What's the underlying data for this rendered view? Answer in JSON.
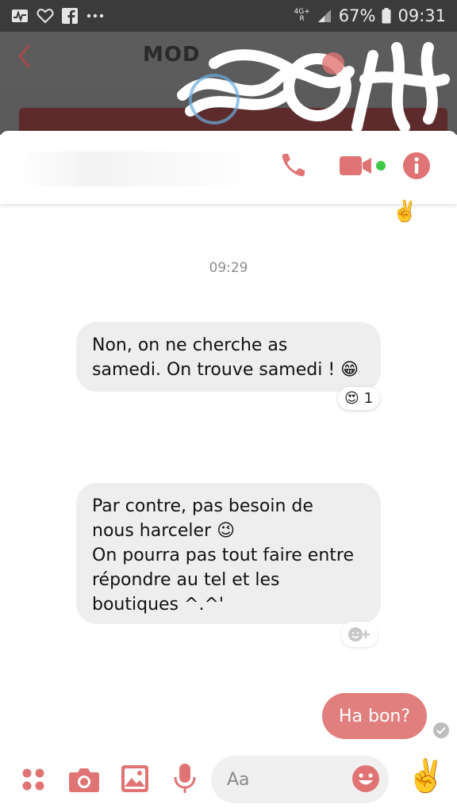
{
  "status_bar": {
    "network_top": "4G+",
    "network_bottom": "R",
    "battery": "67%",
    "time": "09:31"
  },
  "background_app": {
    "back_icon": "chevron-left-icon",
    "title_fragment": "MOD"
  },
  "chat_header": {
    "icons": [
      "phone-icon",
      "video-camera-icon",
      "info-icon"
    ],
    "accent": "#e07474",
    "online_color": "#3ec94a"
  },
  "messages": {
    "timestamp": "09:29",
    "m1": {
      "line1": "Non, on ne cherche as",
      "line2": "samedi. On trouve samedi ! 😁",
      "reaction_emoji": "😍",
      "reaction_count": "1"
    },
    "m2": {
      "line1": "Par contre, pas besoin de",
      "line2": "nous harceler 😉",
      "line3": "On pourra pas tout faire entre",
      "line4": "répondre au tel et les",
      "line5": "boutiques ^.^'"
    },
    "sent": {
      "text": "Ha bon?"
    }
  },
  "composer": {
    "placeholder": "Aa",
    "icons": [
      "apps-grid-icon",
      "camera-icon",
      "image-icon",
      "microphone-icon",
      "emoji-icon",
      "peace-hand-icon"
    ]
  },
  "colors": {
    "bubble_incoming": "#eeeeef",
    "bubble_outgoing": "#e17e7e",
    "accent": "#e07474"
  }
}
